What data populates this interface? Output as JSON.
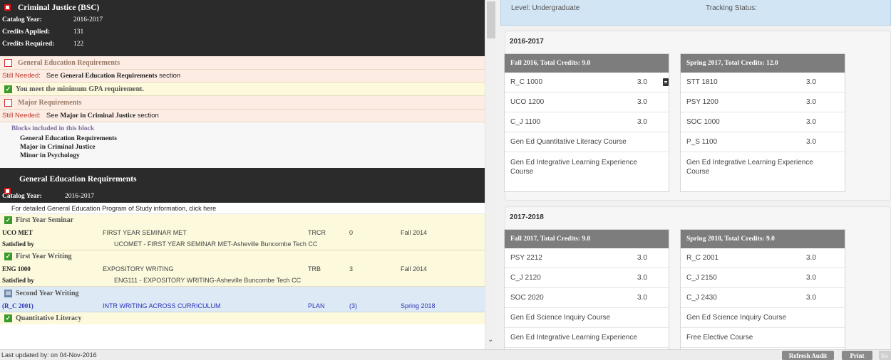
{
  "audit": {
    "header": {
      "title": "Criminal Justice (BSC)",
      "catalog_year_label": "Catalog Year:",
      "catalog_year": "2016-2017",
      "credits_applied_label": "Credits Applied:",
      "credits_applied": "131",
      "credits_required_label": "Credits Required:",
      "credits_required": "122"
    },
    "gen_ed_req_label": "General Education Requirements",
    "still_needed_label": "Still Needed:",
    "see_word": "See",
    "gen_ed_section_name": "General Education Requirements",
    "section_word": "section",
    "gpa_message": "You meet the minimum GPA requirement.",
    "major_req_label": "Major Requirements",
    "major_section_name": "Major in Criminal Justice",
    "blocks_header": "Blocks included in this block",
    "blocks": [
      "General Education Requirements",
      "Major in Criminal Justice",
      "Minor in Psychology"
    ],
    "gen_ed_block": {
      "title": "General Education Requirements",
      "catalog_year_label": "Catalog Year:",
      "catalog_year": "2016-2017",
      "info_text": "For detailed General Education Program of Study information, click here"
    },
    "requirements": [
      {
        "name": "First Year Seminar",
        "course": "UCO MET",
        "course_title": "FIRST YEAR SEMINAR MET",
        "grade": "TRCR",
        "credits": "0",
        "term": "Fall 2014",
        "satisfied_label": "Satisfied by",
        "satisfied_text": "UCOMET - FIRST YEAR SEMINAR MET-Asheville Buncombe Tech CC"
      },
      {
        "name": "First Year Writing",
        "course": "ENG 1000",
        "course_title": "EXPOSITORY WRITING",
        "grade": "TRB",
        "credits": "3",
        "term": "Fall 2014",
        "satisfied_label": "Satisfied by",
        "satisfied_text": "ENG111 - EXPOSITORY WRITING-Asheville Buncombe Tech CC"
      },
      {
        "name": "Second Year Writing",
        "course": "(R_C 2001)",
        "course_title": "INTR WRITING ACROSS CURRICULUM",
        "grade": "PLAN",
        "credits": "(3)",
        "term": "Spring 2018"
      },
      {
        "name": "Quantitative Literacy"
      }
    ]
  },
  "plan": {
    "level_label": "Level: Undergraduate",
    "tracking_label": "Tracking Status:",
    "years": [
      {
        "label": "2016-2017",
        "terms": [
          {
            "header": "Fall 2016, Total Credits: 9.0",
            "courses": [
              {
                "name": "R_C 1000",
                "credits": "3.0",
                "has_note": true
              },
              {
                "name": "UCO 1200",
                "credits": "3.0"
              },
              {
                "name": "C_J 1100",
                "credits": "3.0"
              },
              {
                "name": "Gen Ed Quantitative Literacy Course",
                "credits": ""
              },
              {
                "name": "Gen Ed Integrative Learning Experience Course",
                "credits": ""
              }
            ]
          },
          {
            "header": "Spring 2017, Total Credits: 12.0",
            "courses": [
              {
                "name": "STT 1810",
                "credits": "3.0"
              },
              {
                "name": "PSY 1200",
                "credits": "3.0"
              },
              {
                "name": "SOC 1000",
                "credits": "3.0"
              },
              {
                "name": "P_S 1100",
                "credits": "3.0"
              },
              {
                "name": "Gen Ed Integrative Learning Experience Course",
                "credits": ""
              }
            ]
          }
        ]
      },
      {
        "label": "2017-2018",
        "terms": [
          {
            "header": "Fall 2017, Total Credits: 9.0",
            "courses": [
              {
                "name": "PSY 2212",
                "credits": "3.0"
              },
              {
                "name": "C_J 2120",
                "credits": "3.0"
              },
              {
                "name": "SOC 2020",
                "credits": "3.0"
              },
              {
                "name": "Gen Ed Science Inquiry Course",
                "credits": ""
              },
              {
                "name": "Gen Ed Integrative Learning Experience",
                "credits": ""
              }
            ]
          },
          {
            "header": "Spring 2018, Total Credits: 9.0",
            "courses": [
              {
                "name": "R_C 2001",
                "credits": "3.0"
              },
              {
                "name": "C_J 2150",
                "credits": "3.0"
              },
              {
                "name": "C_J 2430",
                "credits": "3.0"
              },
              {
                "name": "Gen Ed Science Inquiry Course",
                "credits": ""
              },
              {
                "name": "Free Elective Course",
                "credits": ""
              }
            ]
          }
        ]
      }
    ]
  },
  "status_bar": {
    "last_updated": "Last updated by: on 04-Nov-2016",
    "refresh_button": "Refresh Audit",
    "print_button": "Print",
    "save_button": "Sa"
  }
}
